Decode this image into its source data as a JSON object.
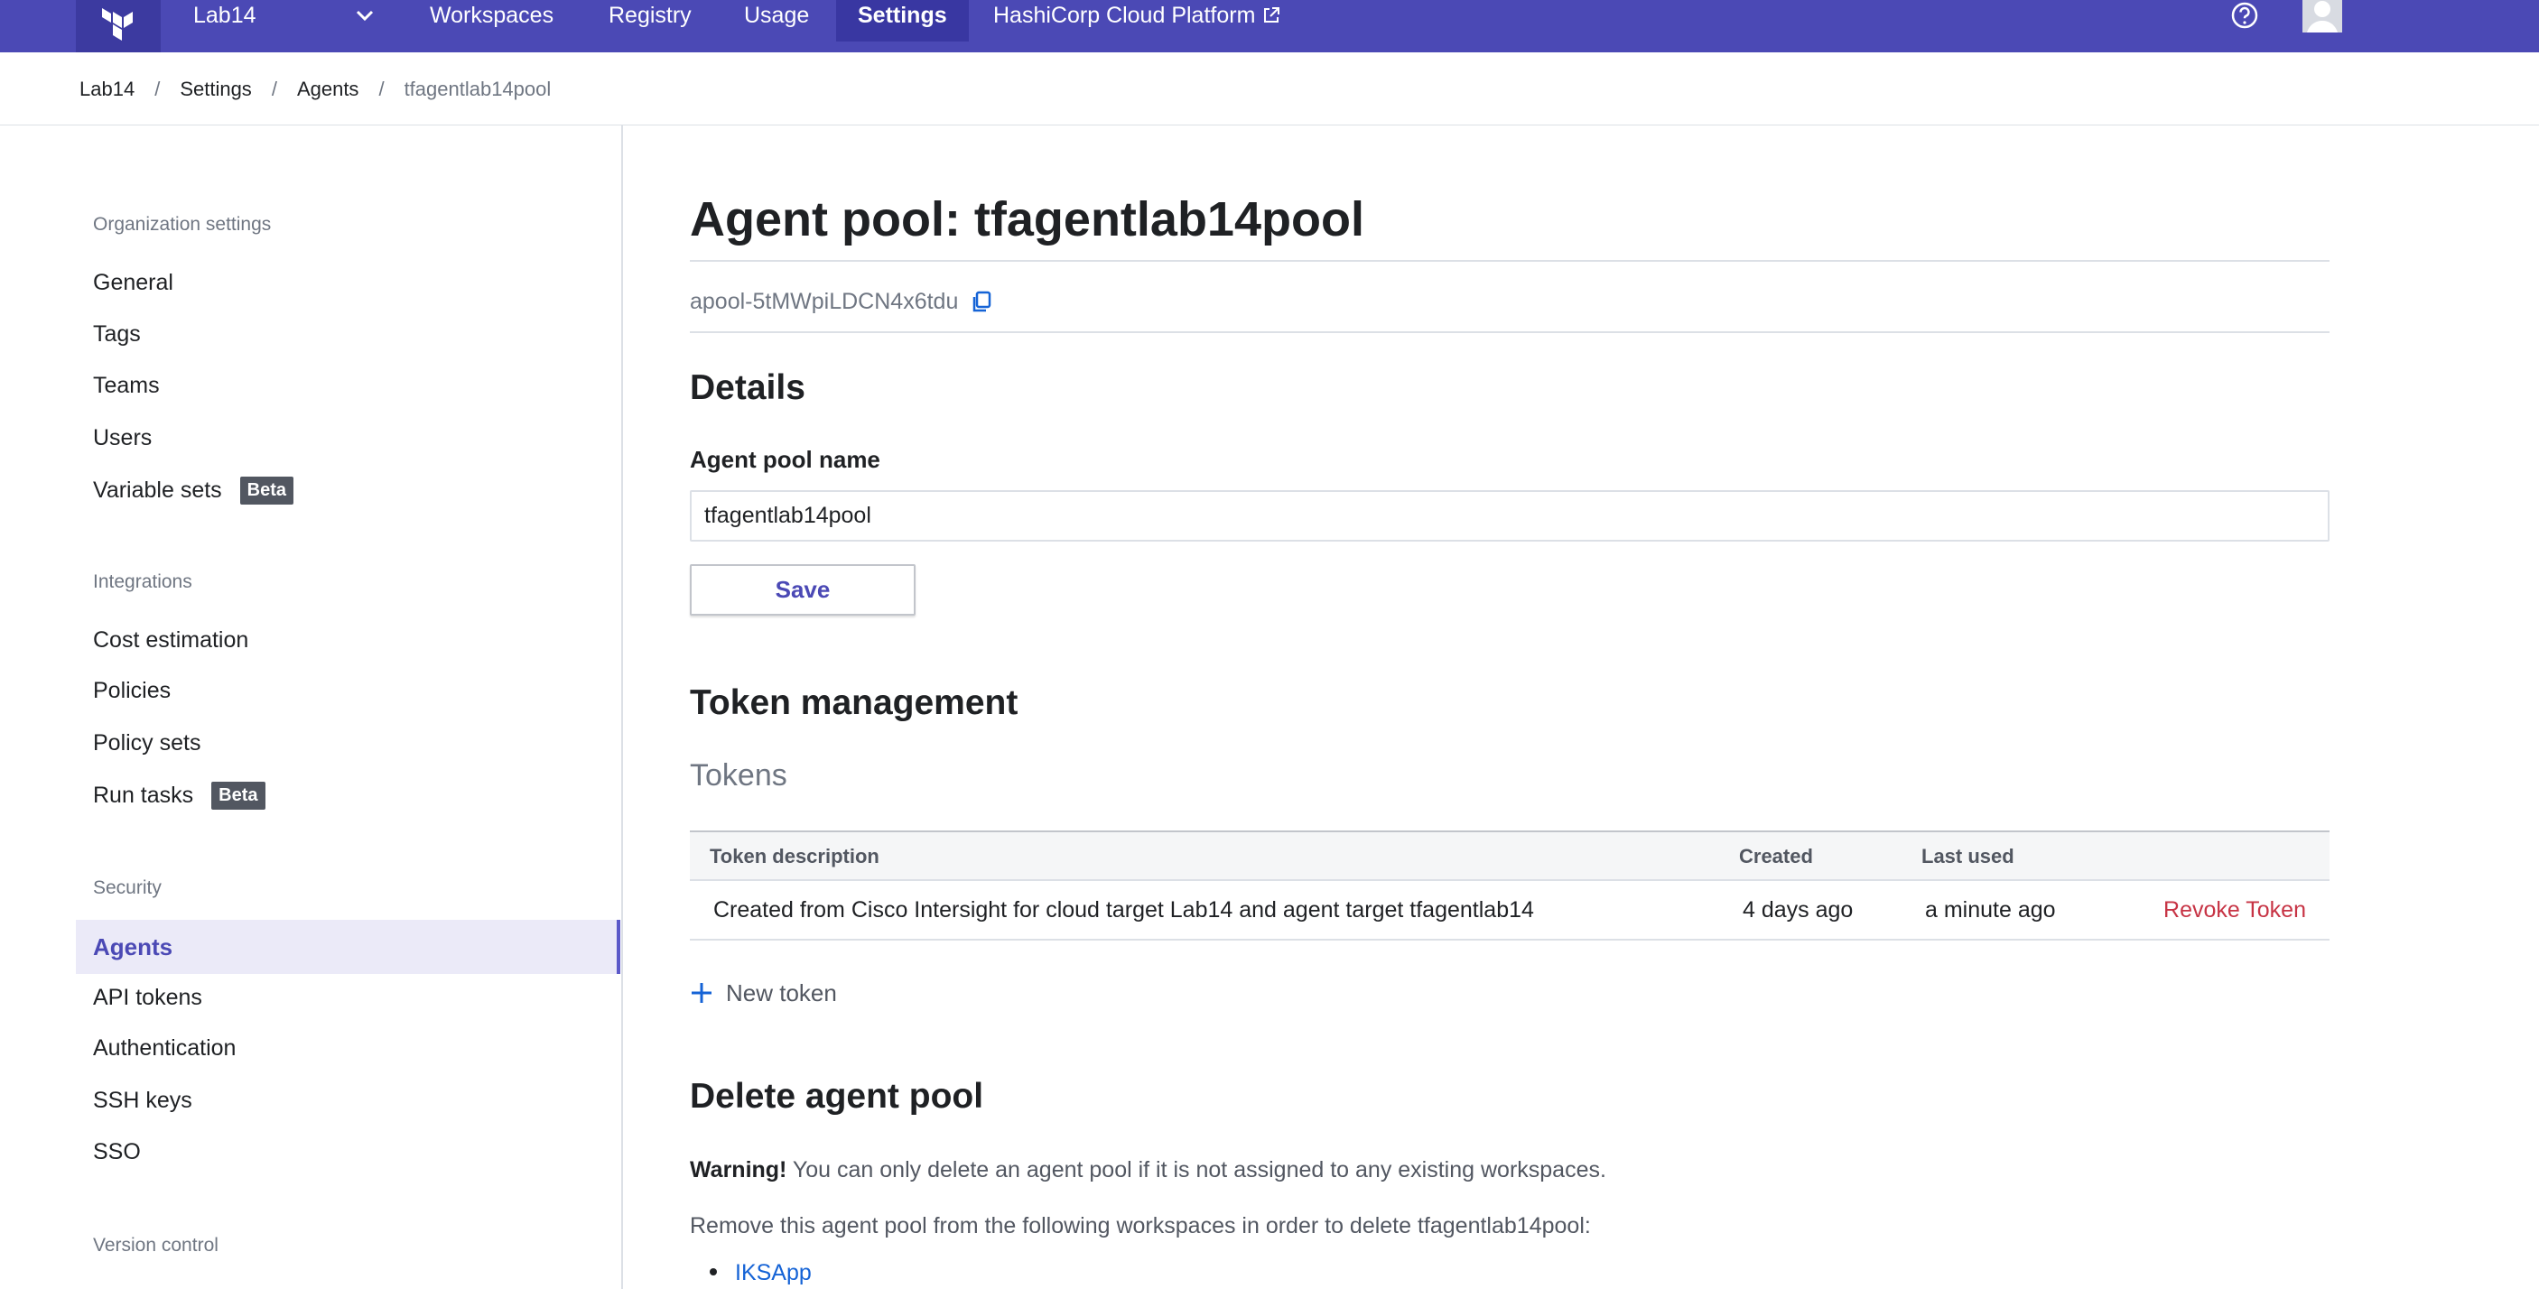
{
  "topnav": {
    "org_name": "Lab14",
    "links": [
      "Workspaces",
      "Registry",
      "Usage",
      "Settings"
    ],
    "active_link": "Settings",
    "hcp_link": "HashiCorp Cloud Platform"
  },
  "breadcrumb": {
    "items": [
      "Lab14",
      "Settings",
      "Agents"
    ],
    "current": "tfagentlab14pool"
  },
  "sidebar": {
    "org_heading": "Organization settings",
    "org_items": [
      "General",
      "Tags",
      "Teams",
      "Users",
      "Variable sets"
    ],
    "variable_sets_badge": "Beta",
    "integrations_heading": "Integrations",
    "integration_items": [
      "Cost estimation",
      "Policies",
      "Policy sets",
      "Run tasks"
    ],
    "run_tasks_badge": "Beta",
    "security_heading": "Security",
    "security_items": [
      "Agents",
      "API tokens",
      "Authentication",
      "SSH keys",
      "SSO"
    ],
    "active_item": "Agents",
    "vcs_heading": "Version control"
  },
  "main": {
    "title": "Agent pool: tfagentlab14pool",
    "pool_id": "apool-5tMWpiLDCN4x6tdu",
    "details_heading": "Details",
    "name_label": "Agent pool name",
    "name_value": "tfagentlab14pool",
    "save_label": "Save",
    "token_heading": "Token management",
    "tokens_subheading": "Tokens",
    "table": {
      "headers": [
        "Token description",
        "Created",
        "Last used"
      ],
      "rows": [
        {
          "description": "Created from Cisco Intersight for cloud target Lab14 and agent target tfagentlab14",
          "created": "4 days ago",
          "last_used": "a minute ago",
          "action": "Revoke Token"
        }
      ]
    },
    "new_token_label": "New token",
    "delete_heading": "Delete agent pool",
    "warning_bold": "Warning!",
    "warning_text": " You can only delete an agent pool if it is not assigned to any existing workspaces.",
    "remove_text": "Remove this agent pool from the following workspaces in order to delete tfagentlab14pool:",
    "workspaces": [
      "IKSApp"
    ]
  },
  "colors": {
    "nav_bg": "#4b49b5",
    "accent": "#4b49b5",
    "danger": "#c73445",
    "link": "#1563d6"
  }
}
